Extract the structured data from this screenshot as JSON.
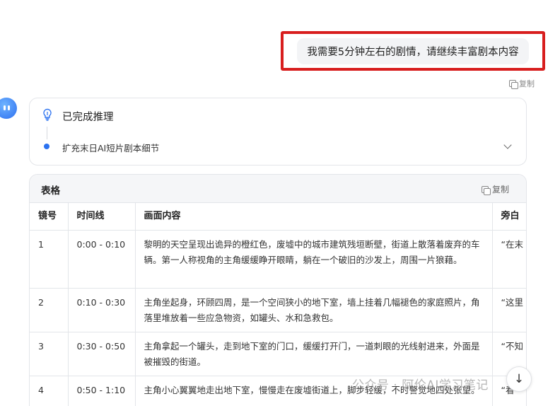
{
  "user_message": {
    "text": "我需要5分钟左右的剧情，请继续丰富剧本内容",
    "copy_label": "复制"
  },
  "reasoning": {
    "title": "已完成推理",
    "step": "扩充末日AI短片剧本细节"
  },
  "table": {
    "title": "表格",
    "copy_label": "复制",
    "columns": [
      "镜号",
      "时间线",
      "画面内容",
      "旁白"
    ],
    "rows": [
      {
        "shot": "1",
        "time": "0:00 - 0:10",
        "scene": "黎明的天空呈现出诡异的橙红色，废墟中的城市建筑残垣断壁，街道上散落着废弃的车辆。第一人称视角的主角缓缓睁开眼睛，躺在一个破旧的沙发上，周围一片狼藉。",
        "narration": "“在末"
      },
      {
        "shot": "2",
        "time": "0:10 - 0:30",
        "scene": "主角坐起身，环顾四周，是一个空间狭小的地下室，墙上挂着几幅褪色的家庭照片，角落里堆放着一些应急物资，如罐头、水和急救包。",
        "narration": "“这里"
      },
      {
        "shot": "3",
        "time": "0:30 - 0:50",
        "scene": "主角拿起一个罐头，走到地下室的门口，缓缓打开门，一道刺眼的光线射进来，外面是被摧毁的街道。",
        "narration": "“不知"
      },
      {
        "shot": "4",
        "time": "0:50 - 1:10",
        "scene": "主角小心翼翼地走出地下室，慢慢走在废墟街道上，脚步轻缓，不时警觉地四处张望。",
        "narration": "“看"
      }
    ]
  },
  "scroll_button": {
    "icon": "arrow-down-icon",
    "glyph": "↓"
  },
  "watermark": {
    "text": "公众号 · 阿伦AI学习笔记"
  },
  "colors": {
    "highlight": "#d81e1e",
    "accent": "#2b72f0"
  }
}
